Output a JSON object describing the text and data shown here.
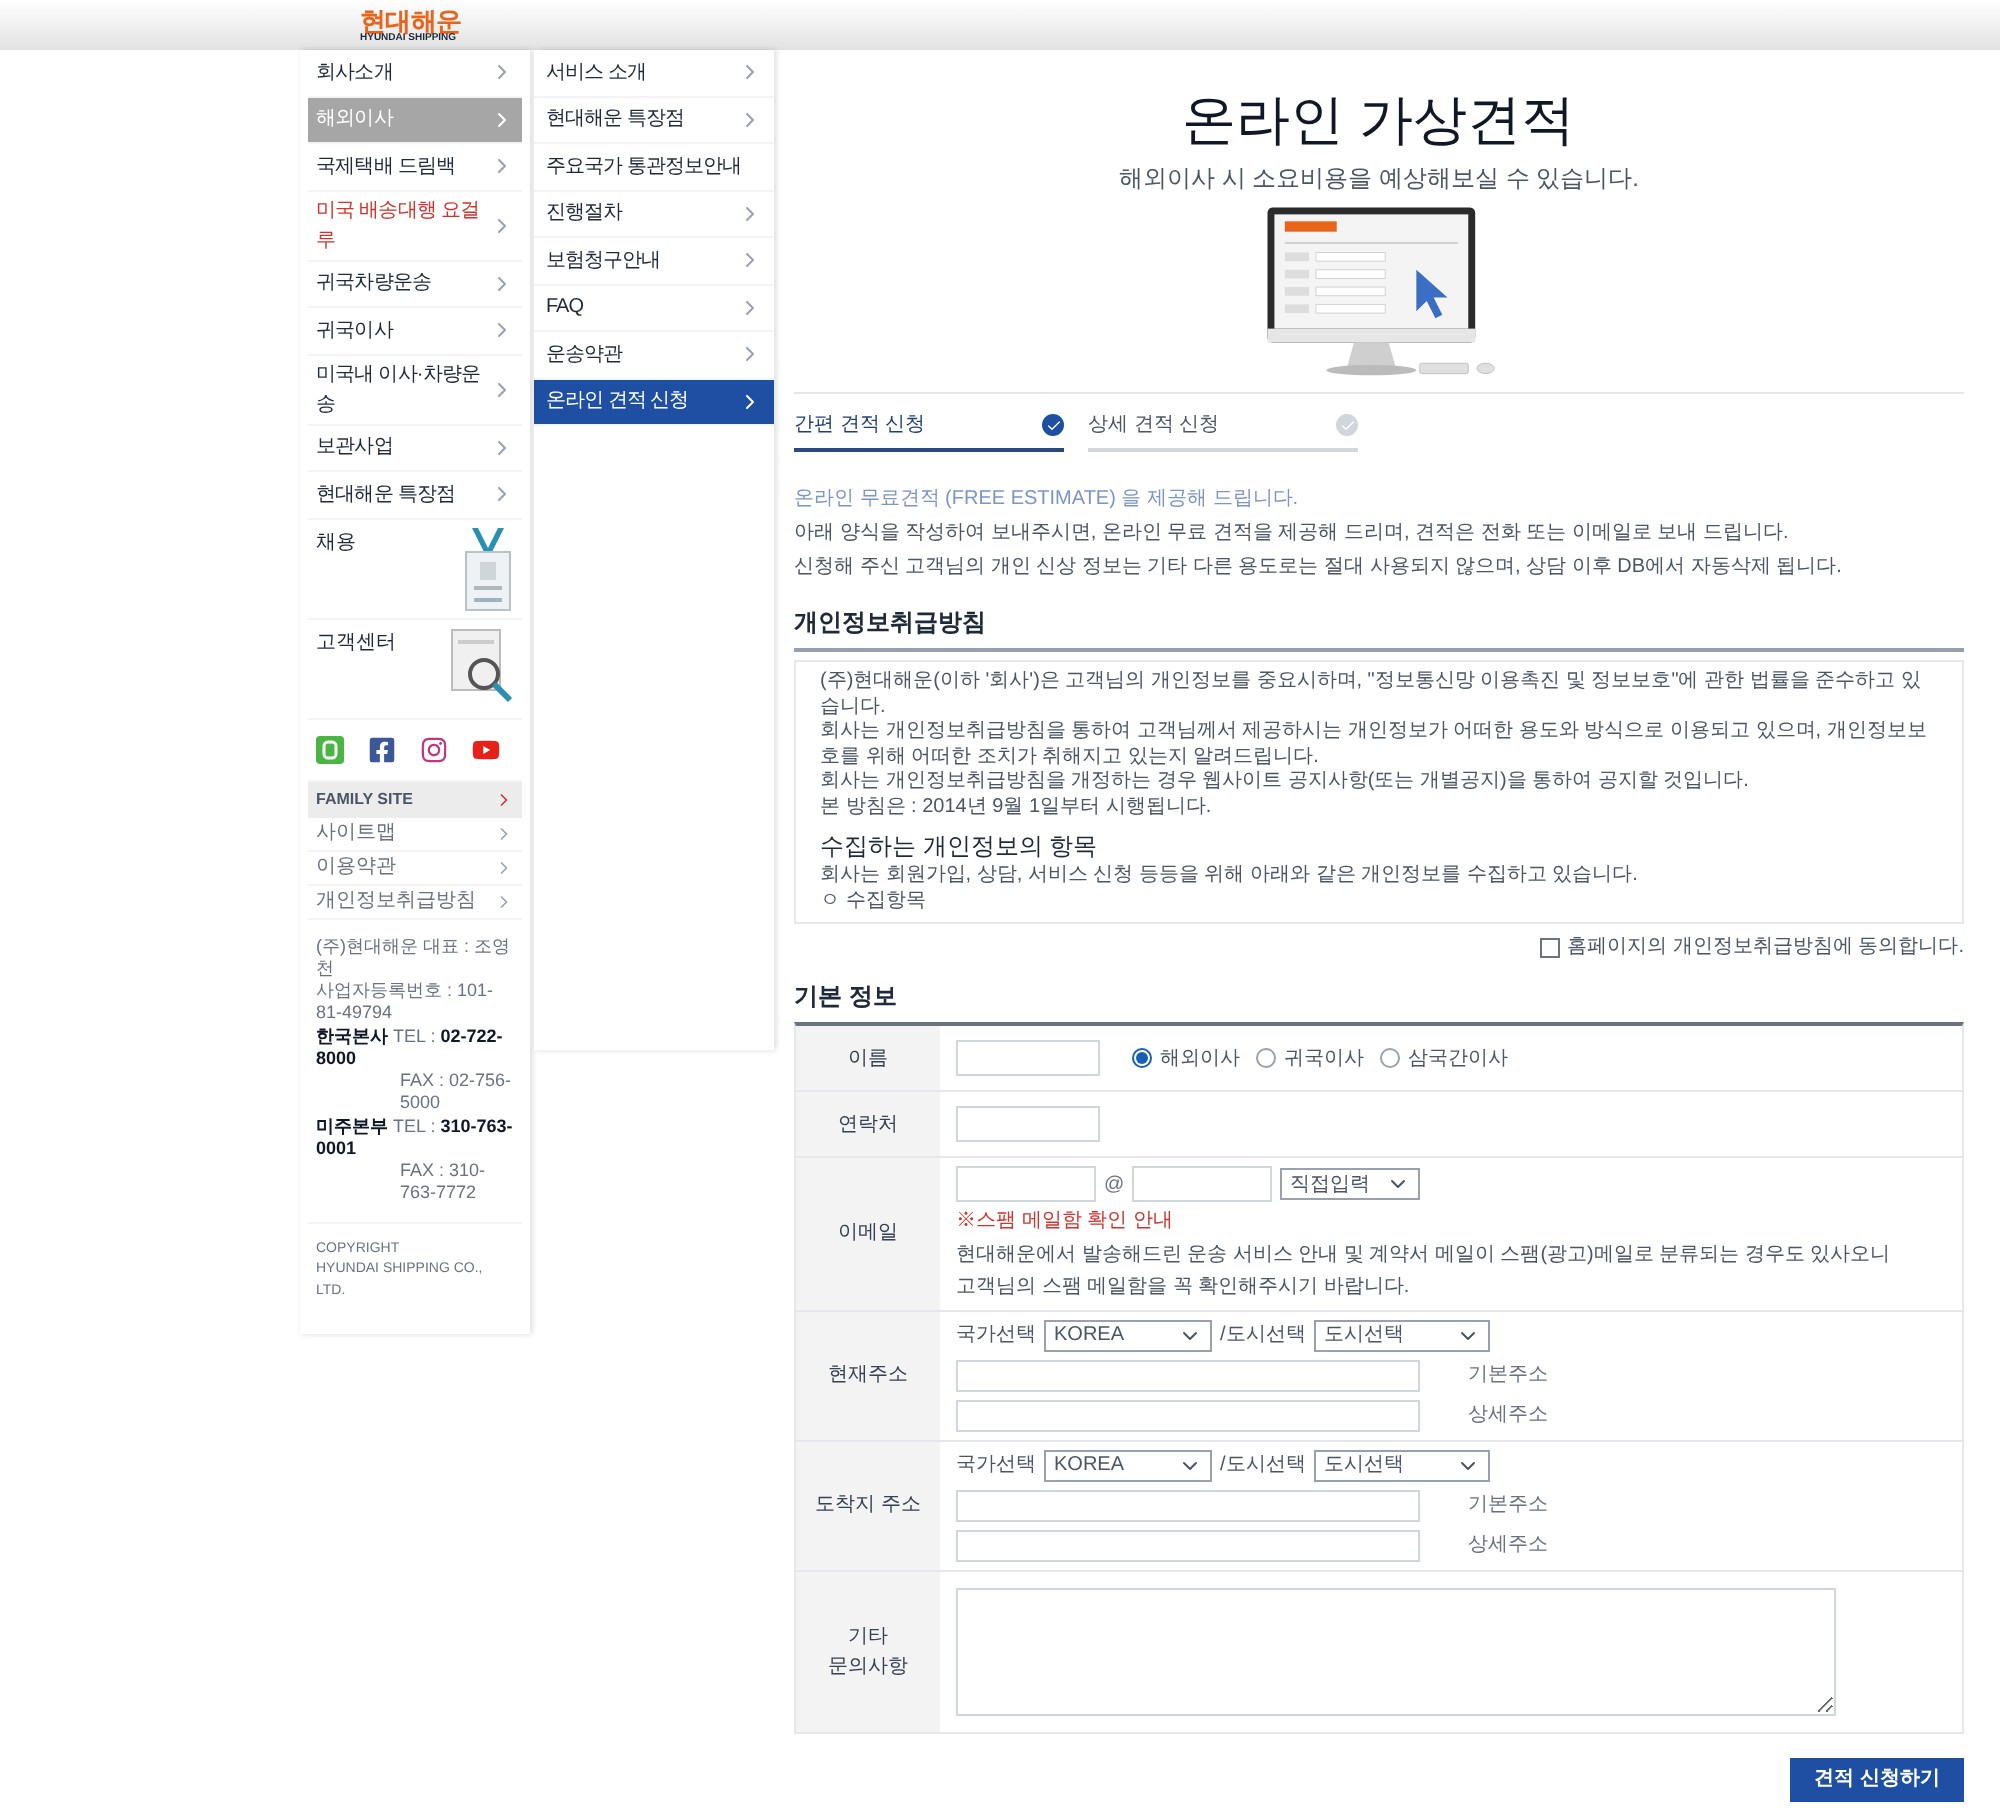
{
  "header": {
    "logo_ko": "현대해운",
    "logo_en": "HYUNDAI SHIPPING"
  },
  "main_menu": [
    {
      "label": "회사소개",
      "selected": false,
      "highlight": false,
      "arrow": true
    },
    {
      "label": "해외이사",
      "selected": true,
      "highlight": false,
      "arrow": true
    },
    {
      "label": "국제택배 드림백",
      "selected": false,
      "highlight": false,
      "arrow": true
    },
    {
      "label": "미국 배송대행 요걸루",
      "selected": false,
      "highlight": true,
      "arrow": true
    },
    {
      "label": "귀국차량운송",
      "selected": false,
      "highlight": false,
      "arrow": true
    },
    {
      "label": "귀국이사",
      "selected": false,
      "highlight": false,
      "arrow": true
    },
    {
      "label": "미국내 이사·차량운송",
      "selected": false,
      "highlight": false,
      "arrow": true
    },
    {
      "label": "보관사업",
      "selected": false,
      "highlight": false,
      "arrow": true
    },
    {
      "label": "현대해운 특장점",
      "selected": false,
      "highlight": false,
      "arrow": true
    }
  ],
  "promo": [
    {
      "kind": "recruit",
      "label": "채용"
    },
    {
      "kind": "support",
      "label": "고객센터"
    }
  ],
  "family_site": {
    "title": "FAMILY SITE",
    "links": [
      "사이트맵",
      "이용약관",
      "개인정보취급방침"
    ]
  },
  "company_info": [
    {
      "kind": "plain",
      "text": "(주)현대해운 대표 : 조영천"
    },
    {
      "kind": "plain",
      "text": "사업자등록번호 : 101-81-49794"
    },
    {
      "kind": "phone",
      "office": "한국본사",
      "label": "TEL :",
      "number": "02-722-8000"
    },
    {
      "kind": "fax",
      "label": "FAX :",
      "number": "02-756-5000"
    },
    {
      "kind": "phone",
      "office": "미주본부",
      "label": "TEL :",
      "number": "310-763-0001"
    },
    {
      "kind": "fax",
      "label": "FAX :",
      "number": "310-763-7772"
    }
  ],
  "copyright": [
    "COPYRIGHT",
    "HYUNDAI SHIPPING CO., LTD."
  ],
  "sub_menu": [
    {
      "label": "서비스 소개",
      "selected": false,
      "arrow": true
    },
    {
      "label": "현대해운 특장점",
      "selected": false,
      "arrow": true
    },
    {
      "label": "주요국가 통관정보안내",
      "selected": false,
      "arrow": false
    },
    {
      "label": "진행절차",
      "selected": false,
      "arrow": true
    },
    {
      "label": "보험청구안내",
      "selected": false,
      "arrow": true
    },
    {
      "label": "FAQ",
      "selected": false,
      "arrow": true
    },
    {
      "label": "운송약관",
      "selected": false,
      "arrow": true
    },
    {
      "label": "온라인 견적 신청",
      "selected": true,
      "arrow": true
    }
  ],
  "page": {
    "title": "온라인 가상견적",
    "subtitle": "해외이사 시 소요비용을 예상해보실 수 있습니다."
  },
  "tabs": [
    {
      "label": "간편 견적 신청",
      "selected": true
    },
    {
      "label": "상세 견적 신청",
      "selected": false
    }
  ],
  "intro": {
    "lead": "온라인 무료견적 (FREE ESTIMATE) 을 제공해 드립니다.",
    "lines": [
      "아래 양식을 작성하여 보내주시면, 온라인 무료 견적을 제공해 드리며, 견적은 전화 또는 이메일로 보내 드립니다.",
      "신청해 주신 고객님의 개인 신상 정보는 기타 다른 용도로는 절대 사용되지 않으며, 상담 이후 DB에서 자동삭제 됩니다."
    ]
  },
  "privacy": {
    "title": "개인정보취급방침",
    "paragraphs": [
      "(주)현대해운(이하 '회사')은 고객님의 개인정보를 중요시하며, \"정보통신망 이용촉진 및 정보보호\"에 관한 법률을 준수하고 있습니다.",
      "회사는 개인정보취급방침을 통하여 고객님께서 제공하시는 개인정보가 어떠한 용도와 방식으로 이용되고 있으며, 개인정보보호를 위해 어떠한 조치가 취해지고 있는지 알려드립니다.",
      "회사는 개인정보취급방침을 개정하는 경우 웹사이트 공지사항(또는 개별공지)을 통하여 공지할 것입니다.",
      "본 방침은 : 2014년 9월 1일부터 시행됩니다."
    ],
    "section_title": "수집하는 개인정보의 항목",
    "section_lines": [
      "회사는 회원가입, 상담, 서비스 신청 등등을 위해 아래와 같은 개인정보를 수집하고 있습니다.",
      "ㅇ 수집항목"
    ],
    "agree": {
      "label": "홈페이지의 개인정보취급방침에 동의합니다.",
      "checked": false
    }
  },
  "basic_info": {
    "title": "기본 정보",
    "rows": [
      {
        "kind": "name",
        "label": "이름",
        "options": [
          {
            "label": "해외이사",
            "selected": true
          },
          {
            "label": "귀국이사",
            "selected": false
          },
          {
            "label": "삼국간이사",
            "selected": false
          }
        ]
      },
      {
        "kind": "contact",
        "label": "연락처"
      },
      {
        "kind": "email",
        "label": "이메일",
        "at": "@",
        "domain_select": "직접입력",
        "notice": "※스팸 메일함 확인 안내",
        "notes": [
          "현대해운에서 발송해드린 운송 서비스 안내 및 계약서 메일이 스팸(광고)메일로 분류되는 경우도 있사오니",
          "고객님의 스팸 메일함을 꼭 확인해주시기 바랍니다."
        ]
      },
      {
        "kind": "address",
        "label": "현재주소",
        "country_label": "국가선택",
        "country": "KOREA",
        "city_label": "/도시선택",
        "city": "도시선택",
        "fields": [
          "기본주소",
          "상세주소"
        ]
      },
      {
        "kind": "address",
        "label": "도착지 주소",
        "country_label": "국가선택",
        "country": "KOREA",
        "city_label": "/도시선택",
        "city": "도시선택",
        "fields": [
          "기본주소",
          "상세주소"
        ]
      },
      {
        "kind": "memo",
        "label_lines": [
          "기타",
          "문의사항"
        ]
      }
    ]
  },
  "submit": "견적 신청하기"
}
